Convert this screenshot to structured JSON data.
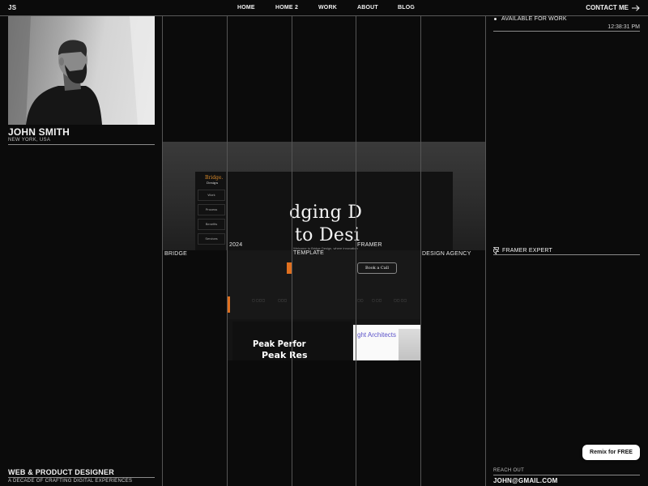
{
  "header": {
    "logo": "JS",
    "nav": [
      "HOME",
      "HOME 2",
      "WORK",
      "ABOUT",
      "BLOG"
    ],
    "contact_label": "CONTACT ME",
    "contact_icon": "arrow-right-icon"
  },
  "profile": {
    "name": "JOHN SMITH",
    "location": "NEW YORK, USA",
    "role": "WEB & PRODUCT DESIGNER",
    "tagline": "A DECADE OF CRAFTING DIGITAL EXPERIENCES"
  },
  "status": {
    "availability": "AVAILABLE FOR WORK",
    "time": "12:38:31 PM",
    "expert_label": "FRAMER EXPERT",
    "expert_icon": "framer-icon"
  },
  "project": {
    "name": "BRIDGE",
    "year": "2024",
    "type": "TEMPLATE",
    "platform": "FRAMER",
    "category": "DESIGN AGENCY"
  },
  "preview": {
    "logo_line1": "Bridge.",
    "logo_line2": "Design",
    "menu": [
      "Work",
      "Process",
      "Benefits",
      "Services"
    ],
    "hero_line1": "dging D",
    "hero_line2": "to Desi",
    "intro_text": "Welcome to Bridge Design, where innovation",
    "book_call": "Book a Call",
    "peak_line1": "Peak Perfor",
    "peak_line2": "Peak Res",
    "architects": "ght Architects"
  },
  "contact": {
    "reach_label": "REACH OUT",
    "email": "JOHN@GMAIL.COM"
  },
  "remix_button": "Remix for FREE",
  "colors": {
    "background": "#0b0b0b",
    "accent_orange": "#e0701f",
    "architects_purple": "#5b52c9"
  }
}
